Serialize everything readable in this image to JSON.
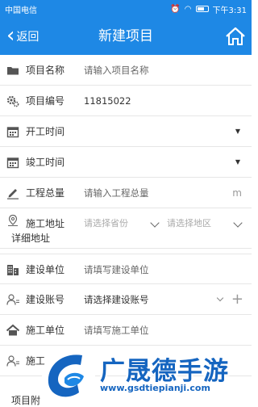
{
  "statusbar": {
    "carrier": "中国电信",
    "time": "下午3:31"
  },
  "navbar": {
    "back_label": "返回",
    "title": "新建项目"
  },
  "form": {
    "project_name": {
      "label": "项目名称",
      "placeholder": "请输入项目名称"
    },
    "project_no": {
      "label": "项目编号",
      "value": "11815022"
    },
    "start_time": {
      "label": "开工时间"
    },
    "end_time": {
      "label": "竣工时间"
    },
    "total_amount": {
      "label": "工程总量",
      "placeholder": "请输入工程总量",
      "unit": "m"
    },
    "site_address": {
      "label": "施工地址",
      "province_placeholder": "请选择省份",
      "area_placeholder": "请选择地区",
      "detail_label": "详细地址"
    },
    "builder_unit": {
      "label": "建设单位",
      "placeholder": "请填写建设单位"
    },
    "builder_account": {
      "label": "建设账号",
      "placeholder": "请选择建设账号"
    },
    "construct_unit": {
      "label": "施工单位",
      "placeholder": "请填写施工单位"
    },
    "construct_account": {
      "label": "施工"
    },
    "attachment": {
      "label": "项目附"
    }
  },
  "watermark": {
    "brand": "广晟德手游",
    "url": "www.gsdtiepianji.com"
  },
  "colors": {
    "accent": "#1e88e5"
  }
}
